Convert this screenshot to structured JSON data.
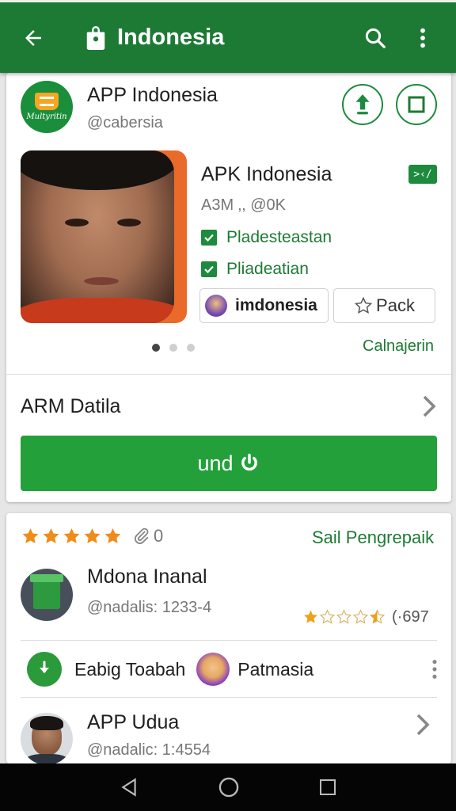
{
  "appbar": {
    "title": "Indonesia"
  },
  "app": {
    "name": "APP Indonesia",
    "handle": "@cabersia",
    "logo_text": "Multyritin"
  },
  "apk": {
    "title": "APK Indonesia",
    "tag": ">‹/",
    "meta": "A3M ‚, @0K",
    "checks": [
      "Pladesteastan",
      "Pliadeatian"
    ],
    "chip_author": "imdonesia",
    "chip_pack": "Pack",
    "cal_link": "Calnajerin"
  },
  "arm": {
    "label": "ARM Datila"
  },
  "install": {
    "label": "und"
  },
  "reviews": {
    "rating_stars": 5,
    "attach_count": "0",
    "sail_link": "Sail Pengrepaik",
    "item1": {
      "name": "Mdona Inanal",
      "handle": "@nadalis: 1233-4",
      "stars": 1.5,
      "count": "(·697"
    },
    "row3": {
      "label1": "Eabig Toabah",
      "label2": "Patmasia"
    },
    "item2": {
      "name": "APP Udua",
      "handle": "@nadalic: 1:4554"
    }
  },
  "colors": {
    "brand_green": "#1d7a35",
    "button_green": "#23a03a",
    "star_orange": "#f08c1a"
  },
  "icons": [
    "back-arrow-icon",
    "shopping-bag-icon",
    "search-icon",
    "more-vert-icon",
    "upload-icon",
    "stop-icon",
    "checkbox-icon",
    "star-icon",
    "chevron-right-icon",
    "power-icon",
    "paperclip-icon",
    "download-icon",
    "nav-back-icon",
    "nav-home-icon",
    "nav-recents-icon"
  ]
}
